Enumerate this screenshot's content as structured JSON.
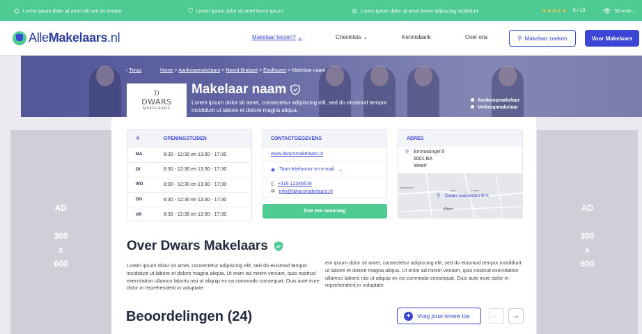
{
  "topbar": {
    "usp1": "Lorem ipsum dolor sit amet elit sed do tempor",
    "usp2": "Lorem ipsum dolor sit amet lorem ipsum",
    "usp3": "Lorem ipsum dolor sit amet lorem adipiscing incididunt",
    "stars": "★★★★★",
    "rating": "8 / 10",
    "reviews": "55 revie..."
  },
  "header": {
    "logo_a": "Alle",
    "logo_b": "Makelaars",
    "logo_c": ".nl",
    "nav": [
      "Makelaar kiezen?",
      "Checklists",
      "Kennisbank",
      "Over ons"
    ],
    "search_label": "Makelaar zoeken",
    "cta_label": "Voor Makelaars"
  },
  "hero": {
    "back": "Terug",
    "crumbs": [
      "Home",
      "Aankoopmakelaars",
      "Noord-Brabant",
      "Eindhoven",
      "Makelaar naam"
    ],
    "logo_d": "D",
    "logo_name": "DWARS",
    "logo_sub": "MAKELAARS",
    "title": "Makelaar naam",
    "desc": "Lorem ipsum dolor sit amet, consectetur adipiscing elit, sed do eiusmod tempor incididunt ut labore et dolore magna aliqua.",
    "tags": [
      "Aankoopmakelaar",
      "Verkoopmakelaar"
    ]
  },
  "ad": {
    "label": "AD",
    "w": "300",
    "x": "x",
    "h": "600"
  },
  "hours": {
    "col1": "#",
    "col2": "OPENINGSTIJDEN",
    "rows": [
      {
        "day": "MA",
        "time": "8:30 - 12:30 en 13:30 - 17:30"
      },
      {
        "day": "DI",
        "time": "8:30 - 12:30 en 13:30 - 17:30"
      },
      {
        "day": "WO",
        "time": "8:30 - 12:30 en 13:30 - 17:30"
      },
      {
        "day": "DO",
        "time": "8:30 - 12:30 en 13:30 - 17:30"
      },
      {
        "day": "VR",
        "time": "8:30 - 12:30 en 13:30 - 17:30"
      }
    ]
  },
  "contact": {
    "title": "CONTACTGEGEVENS",
    "website": "www.dwarsmakelaars.nl",
    "phone_toggle": "Toon telefoonnr en e-mail",
    "phone": "+316 12345678",
    "email": "info@dwarsmakelaars.nl",
    "request": "Doe een aanvraag"
  },
  "address": {
    "title": "ADRES",
    "street": "Emmasingel 5",
    "zip": "6001 BA",
    "city": "Weert",
    "map_pin": "Dwars Makelaars B.V.",
    "map_labels": [
      "Boshoven",
      "Laar",
      "Leuke",
      "Weert"
    ]
  },
  "about": {
    "title": "Over Dwars Makelaars",
    "p1": "Lorem ipsum dolor sit amet, consectetur adipiscing elit, sed do eiusmod tempor incididunt ut labore et dolore magna aliqua. Ut enim ad minim veniam, quis nostrud exercitation ullamco laboris nisi ut aliquip ex ea commodo consequat. Duis aute irure dolor in reprehenderit in voluptate",
    "p2": "em ipsum dolor sit amet, consectetur adipiscing elit, sed do eiusmod tempor incididunt ut labore et dolore magna aliqua. Ut enim ad minim veniam, quis nostrud exercitation ullamco laboris nisi ut aliquip ex ea commodo consequat. Duis aute irure dolor in reprehenderit in voluptate"
  },
  "reviews": {
    "title": "Beoordelingen (24)",
    "add": "Voeg jouw review toe",
    "prev": "←",
    "next": "→"
  },
  "colors": {
    "primary": "#3b46d4",
    "green": "#4ecb93",
    "dark": "#222a3f"
  }
}
